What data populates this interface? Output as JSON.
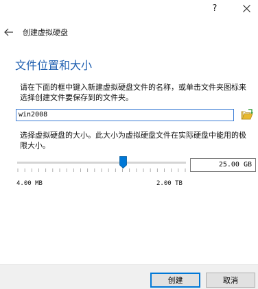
{
  "titlebar": {
    "help_label": "?"
  },
  "nav": {
    "title": "创建虚拟硬盘"
  },
  "section": {
    "heading": "文件位置和大小",
    "location_description": "请在下面的框中键入新建虚拟硬盘文件的名称，或单击文件夹图标来选择创建文件要保存到的文件夹。",
    "size_description": "选择虚拟硬盘的大小。此大小为虚拟硬盘文件在实际硬盘中能用的极限大小。"
  },
  "file_location": {
    "value": "win2008"
  },
  "size": {
    "value": "25.00 GB",
    "slider_min_label": "4.00 MB",
    "slider_max_label": "2.00 TB",
    "slider_level": 0.63
  },
  "buttons": {
    "create": "创建",
    "cancel": "取消"
  },
  "colors": {
    "heading": "#1f5fb0",
    "accent": "#0078d7",
    "folder_icon": "#e8b92f"
  },
  "icons": {
    "back": "back-arrow-icon",
    "close": "close-icon",
    "folder": "folder-open-icon",
    "slider": "slider-handle"
  }
}
